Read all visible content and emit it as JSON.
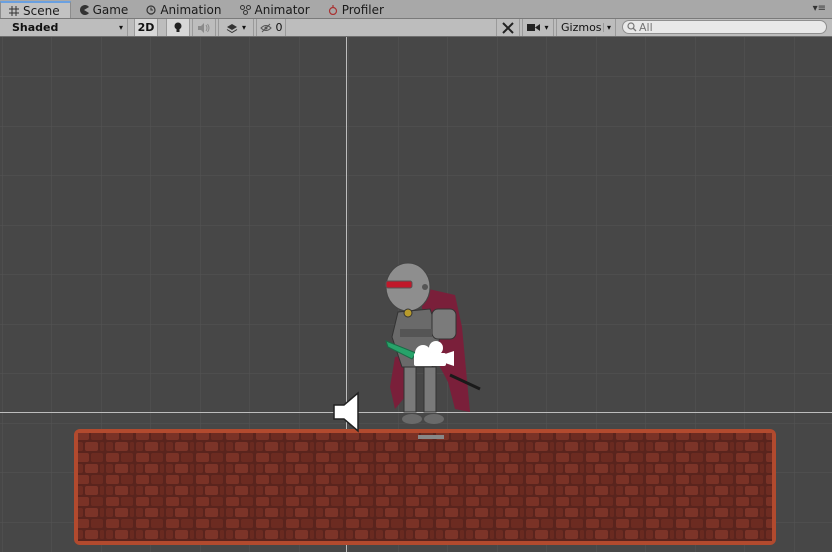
{
  "tabs": [
    {
      "label": "Scene",
      "icon": "grid-icon",
      "active": true
    },
    {
      "label": "Game",
      "icon": "pacman-icon",
      "active": false
    },
    {
      "label": "Animation",
      "icon": "clock-icon",
      "active": false
    },
    {
      "label": "Animator",
      "icon": "nodes-icon",
      "active": false
    },
    {
      "label": "Profiler",
      "icon": "profiler-icon",
      "active": false
    }
  ],
  "toolbar": {
    "draw_mode": "Shaded",
    "mode_2d": "2D",
    "hidden_count": "0",
    "gizmos": "Gizmos",
    "search_placeholder": "All"
  },
  "colors": {
    "viewport_bg": "#474747",
    "grid_line": "#545454",
    "platform": "#6a2e24",
    "platform_border": "#b24a2e",
    "toolbar_bg": "#bdbdbd"
  }
}
